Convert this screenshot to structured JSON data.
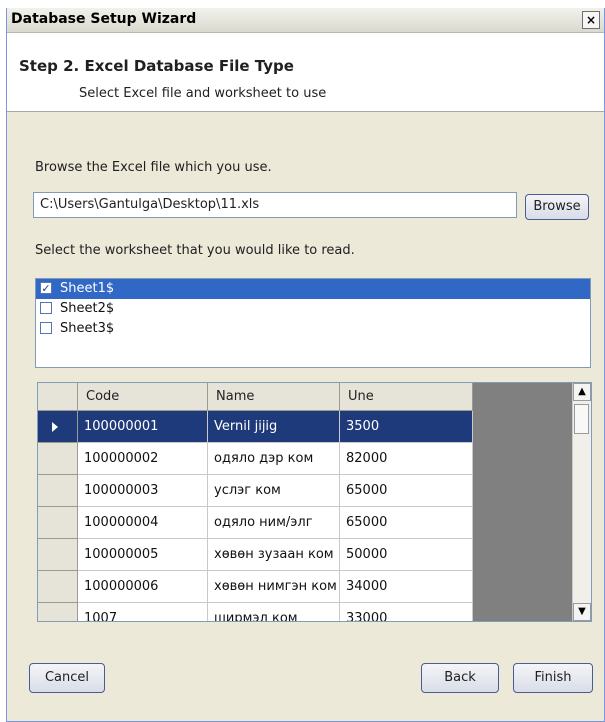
{
  "window": {
    "title": "Database Setup Wizard",
    "close_glyph": "×"
  },
  "header": {
    "step_title": "Step 2. Excel Database File Type",
    "step_subtitle": "Select Excel file and worksheet to use"
  },
  "file": {
    "prompt": "Browse the Excel file which you use.",
    "path": "C:\\Users\\Gantulga\\Desktop\\11.xls",
    "browse_label": "Browse"
  },
  "worksheet": {
    "prompt": "Select the worksheet that you would like to read.",
    "sheets": [
      {
        "name": "Sheet1$",
        "checked": true,
        "selected": true
      },
      {
        "name": "Sheet2$",
        "checked": false,
        "selected": false
      },
      {
        "name": "Sheet3$",
        "checked": false,
        "selected": false
      }
    ],
    "check_glyph": "✓"
  },
  "grid": {
    "columns": [
      "Code",
      "Name",
      "Une"
    ],
    "rows": [
      [
        "100000001",
        "Vernil jijig",
        "3500"
      ],
      [
        "100000002",
        "одяло дэр ком",
        "82000"
      ],
      [
        "100000003",
        "услэг ком",
        "65000"
      ],
      [
        "100000004",
        "одяло ним/элг",
        "65000"
      ],
      [
        "100000005",
        "хөвөн зузаан ком",
        "50000"
      ],
      [
        "100000006",
        "хөвөн нимгэн ком",
        "34000"
      ],
      [
        "1007",
        "ширмэл ком",
        "33000"
      ]
    ],
    "selected_row": 0,
    "scroll_up_glyph": "▲",
    "scroll_down_glyph": "▼"
  },
  "buttons": {
    "cancel": "Cancel",
    "back": "Back",
    "finish": "Finish"
  }
}
